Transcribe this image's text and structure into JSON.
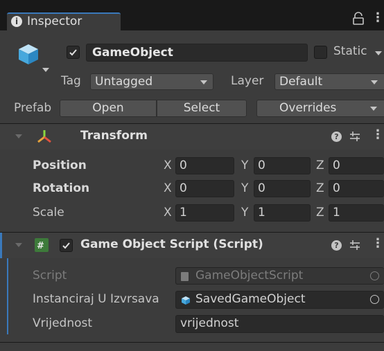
{
  "tab": {
    "label": "Inspector",
    "lock_icon": "lock-icon",
    "menu_icon": "kebab-menu-icon"
  },
  "gameobject": {
    "active": true,
    "name": "GameObject",
    "static_label": "Static",
    "tag_label": "Tag",
    "tag_value": "Untagged",
    "layer_label": "Layer",
    "layer_value": "Default",
    "prefab_label": "Prefab",
    "prefab_open": "Open",
    "prefab_select": "Select",
    "prefab_overrides": "Overrides"
  },
  "transform": {
    "title": "Transform",
    "rows": [
      {
        "label": "Position",
        "x": "0",
        "y": "0",
        "z": "0"
      },
      {
        "label": "Rotation",
        "x": "0",
        "y": "0",
        "z": "0"
      },
      {
        "label": "Scale",
        "x": "1",
        "y": "1",
        "z": "1"
      }
    ],
    "axis_x": "X",
    "axis_y": "Y",
    "axis_z": "Z"
  },
  "script_component": {
    "enabled": true,
    "title": "Game Object Script (Script)",
    "script_label": "Script",
    "script_value": "GameObjectScript",
    "instanciraj_label": "Instanciraj U Izvrsava",
    "instanciraj_value": "SavedGameObject",
    "vrijednost_label": "Vrijednost",
    "vrijednost_value": "vrijednost"
  },
  "colors": {
    "accent_blue": "#3a79bb",
    "panel_bg": "#3c3c3c",
    "header_bg": "#3e3e3e"
  }
}
